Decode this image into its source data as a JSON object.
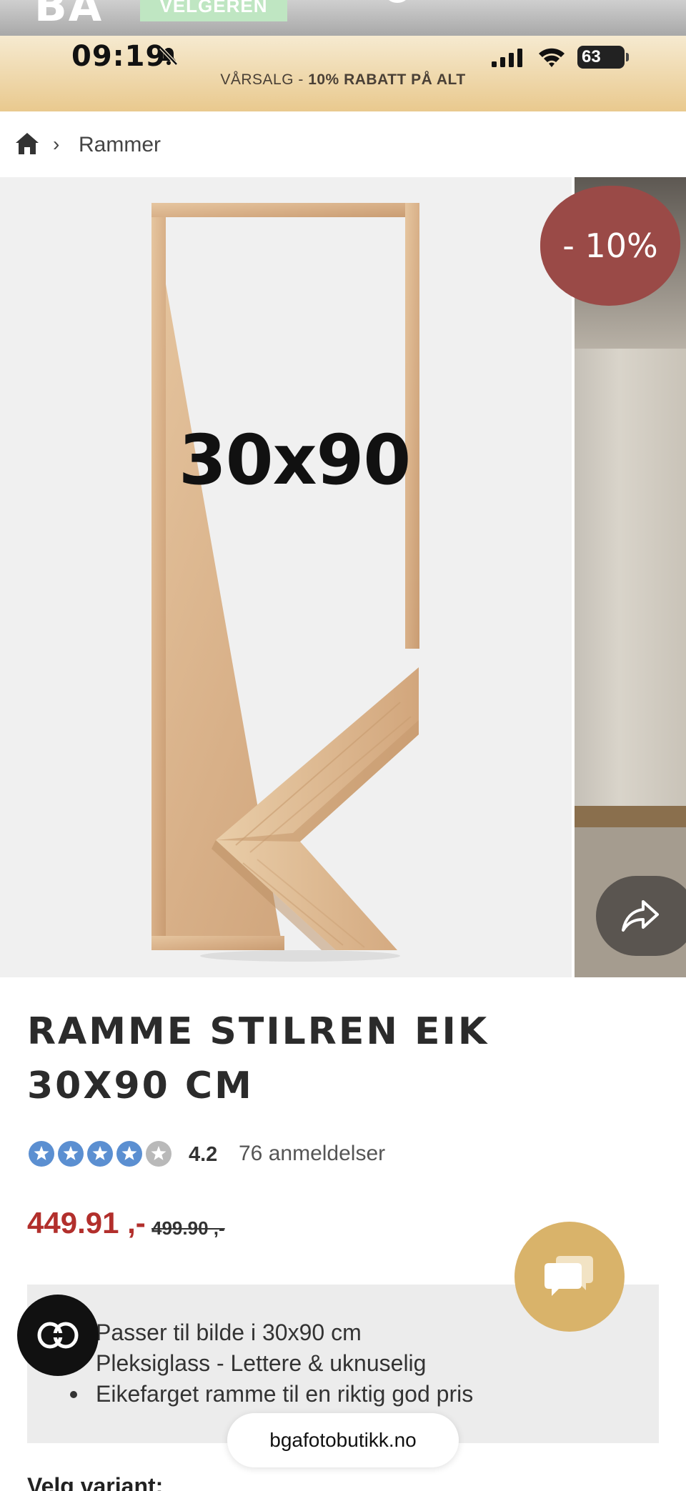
{
  "header": {
    "logo_text": "BA",
    "winner_badge": "VELGEREN",
    "search_icon": "search-icon",
    "menu_icon": "menu-icon"
  },
  "status_bar": {
    "time": "09:19",
    "battery": "63",
    "icons": [
      "bell-mute-icon",
      "signal-icon",
      "wifi-icon",
      "battery-icon"
    ]
  },
  "promo": {
    "prefix": "VÅRSALG - ",
    "highlight": "10% RABATT PÅ ALT"
  },
  "breadcrumb": {
    "home_icon": "home-icon",
    "current": "Rammer"
  },
  "gallery": {
    "image_label": "30x90",
    "discount_badge": "- 10%",
    "share_icon": "share-icon"
  },
  "product": {
    "title": "RAMME STILREN EIK 30X90 CM",
    "rating_value": "4.2",
    "rating_stars": 4.2,
    "rating_count": "76 anmeldelser",
    "price": "449.91 ,-",
    "price_old": "499.90 ,-",
    "features": [
      "Passer til bilde i 30x90 cm",
      "Pleksiglass - Lettere & uknuselig",
      "Eikefarget ramme til en riktig god pris"
    ],
    "variant_label": "Velg variant:"
  },
  "browser": {
    "url": "bgafotobutikk.no",
    "reader_icon": "reader-mode-icon",
    "chat_icon": "chat-icon"
  },
  "colors": {
    "promo_bg": "#e9c98e",
    "price": "#b22f2c",
    "badge": "#9a4a47",
    "chat_button": "#d9b36a",
    "star": "#5b8fd1"
  }
}
